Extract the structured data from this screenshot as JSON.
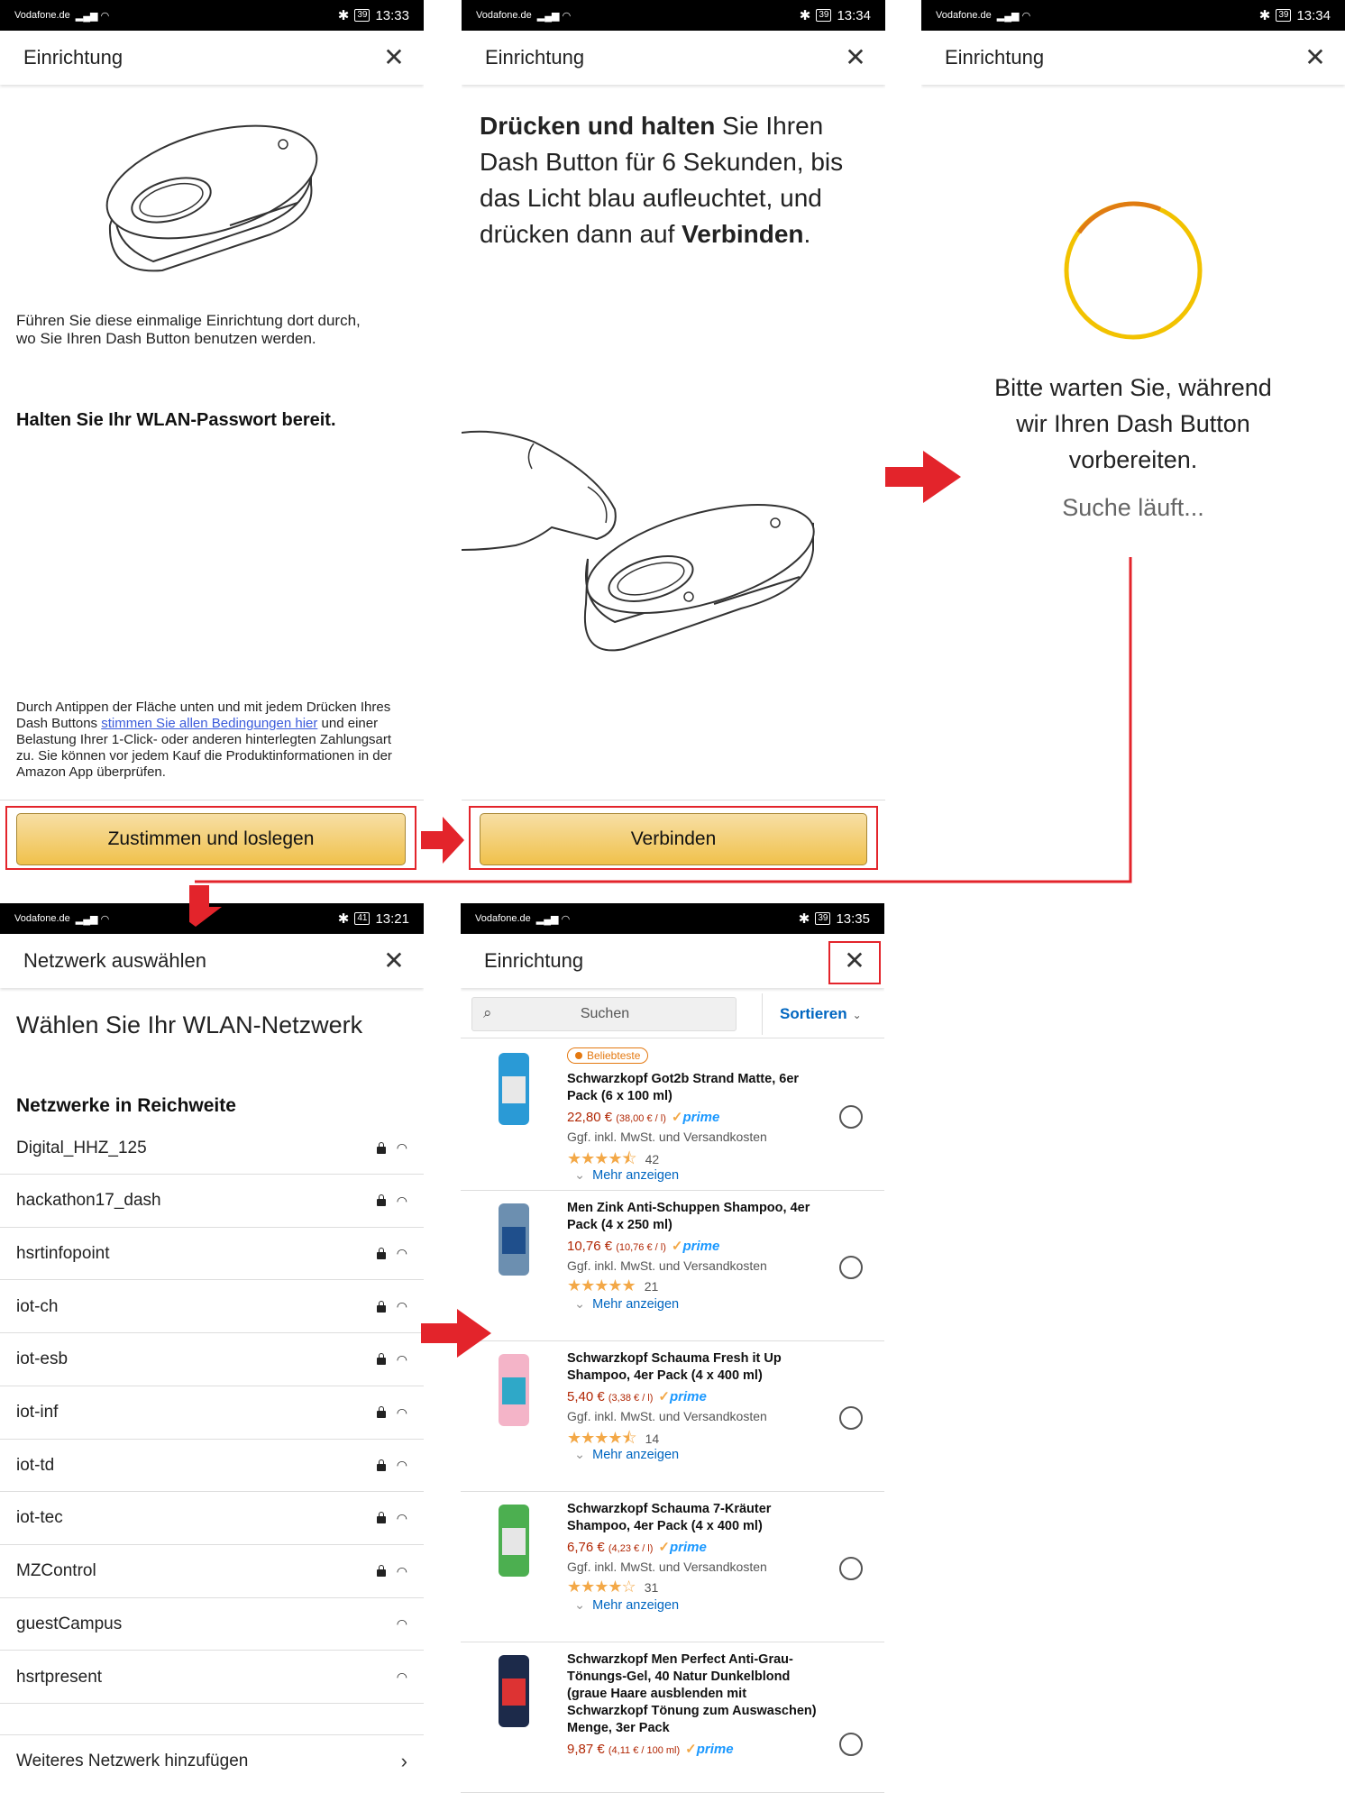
{
  "status_bars": [
    {
      "carrier": "Vodafone.de",
      "battery": "39",
      "time": "13:33"
    },
    {
      "carrier": "Vodafone.de",
      "battery": "39",
      "time": "13:34"
    },
    {
      "carrier": "Vodafone.de",
      "battery": "39",
      "time": "13:34"
    },
    {
      "carrier": "Vodafone.de",
      "battery": "41",
      "time": "13:21"
    },
    {
      "carrier": "Vodafone.de",
      "battery": "39",
      "time": "13:35"
    }
  ],
  "screen1": {
    "title": "Einrichtung",
    "intro": "Führen Sie diese einmalige Einrichtung dort durch, wo Sie Ihren Dash Button benutzen werden.",
    "wifi_note": "Halten Sie Ihr WLAN-Passwort bereit.",
    "legal_before": "Durch Antippen der Fläche unten und mit jedem Drücken Ihres Dash Buttons ",
    "legal_link": "stimmen Sie allen Bedingungen hier",
    "legal_after": " und einer Belastung Ihrer 1-Click- oder anderen hinterlegten Zahlungsart zu. Sie können vor jedem Kauf die Produktinformationen in der Amazon App überprüfen.",
    "button": "Zustimmen und loslegen"
  },
  "screen2": {
    "title": "Einrichtung",
    "instr_bold1": "Drücken und halten",
    "instr_mid": " Sie Ihren Dash Button für 6 Sekunden, bis das Licht blau aufleuchtet, und drücken dann auf ",
    "instr_bold2": "Verbinden",
    "instr_end": ".",
    "button": "Verbinden"
  },
  "screen3": {
    "title": "Einrichtung",
    "wait_text": "Bitte warten Sie, während wir Ihren Dash Button vorbereiten.",
    "searching": "Suche läuft..."
  },
  "screen4": {
    "title": "Netzwerk auswählen",
    "heading": "Wählen Sie Ihr WLAN-Netzwerk",
    "section": "Netzwerke in Reichweite",
    "networks": [
      {
        "name": "Digital_HHZ_125",
        "locked": true
      },
      {
        "name": "hackathon17_dash",
        "locked": true
      },
      {
        "name": "hsrtinfopoint",
        "locked": true
      },
      {
        "name": "iot-ch",
        "locked": true
      },
      {
        "name": "iot-esb",
        "locked": true
      },
      {
        "name": "iot-inf",
        "locked": true
      },
      {
        "name": "iot-td",
        "locked": true
      },
      {
        "name": "iot-tec",
        "locked": true
      },
      {
        "name": "MZControl",
        "locked": true
      },
      {
        "name": "guestCampus",
        "locked": false
      },
      {
        "name": "hsrtpresent",
        "locked": false
      }
    ],
    "add_network": "Weiteres Netzwerk hinzufügen"
  },
  "screen5": {
    "title": "Einrichtung",
    "search_placeholder": "Suchen",
    "sort_label": "Sortieren",
    "badge": "Beliebteste",
    "ship_note": "Ggf. inkl. MwSt. und Versandkosten",
    "more_label": "Mehr anzeigen",
    "prime_label": "prime",
    "products": [
      {
        "title": "Schwarzkopf Got2b Strand Matte, 6er Pack (6 x 100 ml)",
        "price": "22,80 €",
        "unit": "(38,00 € / l)",
        "stars": 4.5,
        "reviews": "42"
      },
      {
        "title": "Men Zink Anti-Schuppen Shampoo, 4er Pack (4 x 250 ml)",
        "price": "10,76 €",
        "unit": "(10,76 € / l)",
        "stars": 5,
        "reviews": "21"
      },
      {
        "title": "Schwarzkopf Schauma Fresh it Up Shampoo, 4er Pack (4 x 400 ml)",
        "price": "5,40 €",
        "unit": "(3,38 € / l)",
        "stars": 4.5,
        "reviews": "14"
      },
      {
        "title": "Schwarzkopf Schauma 7-Kräuter Shampoo, 4er Pack (4 x 400 ml)",
        "price": "6,76 €",
        "unit": "(4,23 € / l)",
        "stars": 4,
        "reviews": "31"
      },
      {
        "title": "Schwarzkopf Men Perfect Anti-Grau-Tönungs-Gel, 40 Natur Dunkelblond (graue Haare ausblenden mit Schwarzkopf Tönung zum Auswaschen) Menge, 3er Pack",
        "price": "9,87 €",
        "unit": "(4,11 € / 100 ml)",
        "stars": 0,
        "reviews": ""
      }
    ]
  },
  "colors": {
    "accent_red": "#e3242b",
    "button_yellow": "#f0c14b",
    "spinner": "#f0b400",
    "link": "#0066c0",
    "price": "#b12704"
  }
}
